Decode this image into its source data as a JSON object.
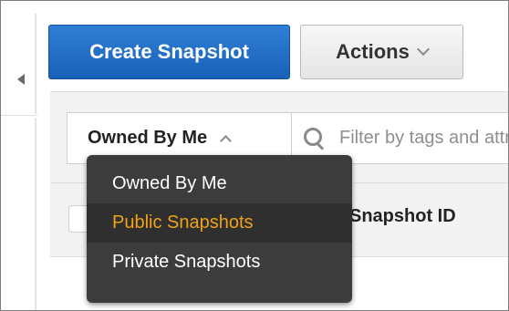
{
  "toolbar": {
    "create_label": "Create Snapshot",
    "actions_label": "Actions"
  },
  "filter": {
    "owner_selected": "Owned By Me",
    "search_placeholder": "Filter by tags and attributes or search by keyword"
  },
  "table": {
    "columns": [
      "",
      "Snapshot ID"
    ]
  },
  "owner_menu": {
    "items": [
      {
        "label": "Owned By Me"
      },
      {
        "label": "Public Snapshots"
      },
      {
        "label": "Private Snapshots"
      }
    ],
    "highlighted_item": "Public Snapshots"
  },
  "colors": {
    "primary_button": "#1f6fc9",
    "menu_highlight_text": "#f0a21b",
    "menu_background": "#3c3c3c"
  },
  "icons": {
    "collapse": "caret-left-icon",
    "actions": "chevron-down-icon",
    "owner_select": "chevron-up-icon",
    "search": "search-icon"
  }
}
